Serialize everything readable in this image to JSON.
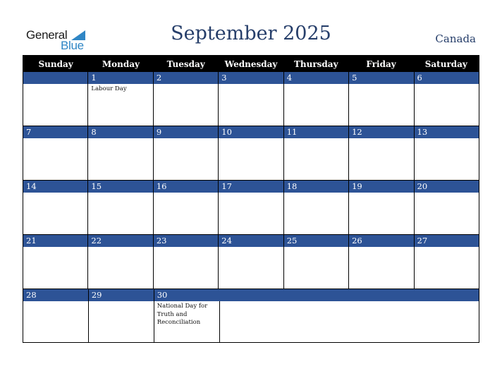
{
  "logo": {
    "line1": "General",
    "line2": "Blue"
  },
  "header": {
    "title": "September 2025",
    "country": "Canada"
  },
  "colors": {
    "title": "#263e6a",
    "day_bar": "#2d5396",
    "header_bg": "#000000",
    "logo_blue": "#2f86c5"
  },
  "weekdays": [
    "Sunday",
    "Monday",
    "Tuesday",
    "Wednesday",
    "Thursday",
    "Friday",
    "Saturday"
  ],
  "weeks": [
    [
      {
        "day": ""
      },
      {
        "day": "1",
        "holiday": "Labour Day"
      },
      {
        "day": "2"
      },
      {
        "day": "3"
      },
      {
        "day": "4"
      },
      {
        "day": "5"
      },
      {
        "day": "6"
      }
    ],
    [
      {
        "day": "7"
      },
      {
        "day": "8"
      },
      {
        "day": "9"
      },
      {
        "day": "10"
      },
      {
        "day": "11"
      },
      {
        "day": "12"
      },
      {
        "day": "13"
      }
    ],
    [
      {
        "day": "14"
      },
      {
        "day": "15"
      },
      {
        "day": "16"
      },
      {
        "day": "17"
      },
      {
        "day": "18"
      },
      {
        "day": "19"
      },
      {
        "day": "20"
      }
    ],
    [
      {
        "day": "21"
      },
      {
        "day": "22"
      },
      {
        "day": "23"
      },
      {
        "day": "24"
      },
      {
        "day": "25"
      },
      {
        "day": "26"
      },
      {
        "day": "27"
      }
    ],
    [
      {
        "day": "28"
      },
      {
        "day": "29"
      },
      {
        "day": "30",
        "holiday": "National Day for Truth and Reconciliation"
      },
      {
        "day": ""
      },
      {
        "day": ""
      },
      {
        "day": ""
      },
      {
        "day": ""
      }
    ]
  ]
}
